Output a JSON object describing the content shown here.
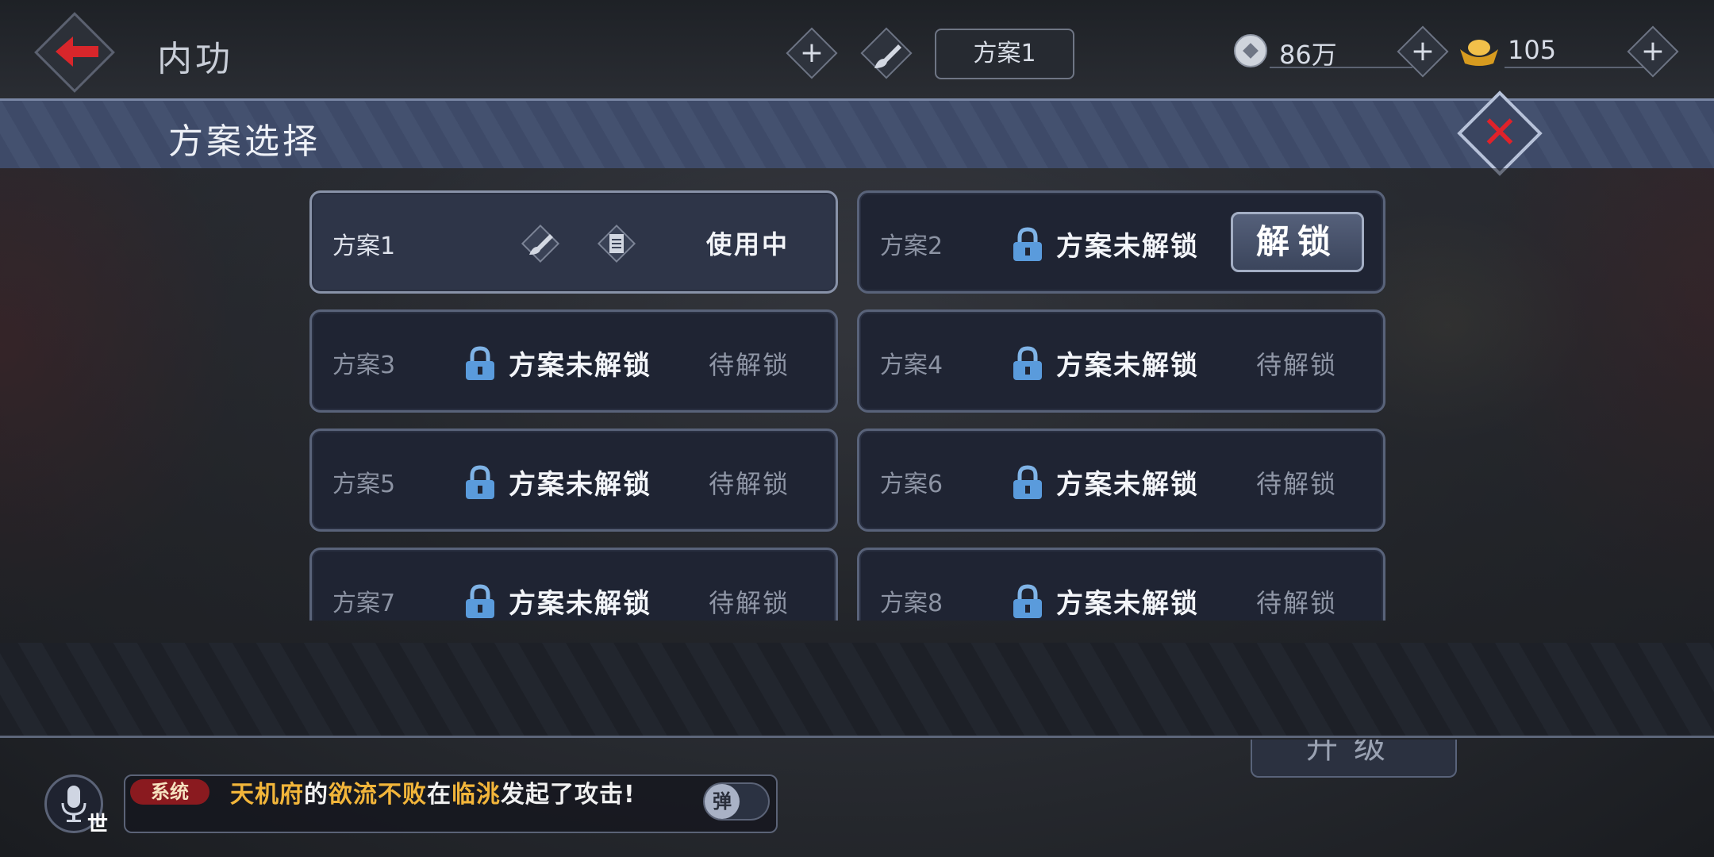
{
  "header": {
    "title": "内功",
    "plan_chip": "方案1"
  },
  "currency": {
    "coins": "86万",
    "ingots": "105"
  },
  "dialog": {
    "title": "方案选择"
  },
  "slots": [
    {
      "name": "方案1",
      "status": "使用中"
    },
    {
      "name": "方案2",
      "locked_text": "方案未解锁",
      "action": "解锁"
    },
    {
      "name": "方案3",
      "locked_text": "方案未解锁",
      "status": "待解锁"
    },
    {
      "name": "方案4",
      "locked_text": "方案未解锁",
      "status": "待解锁"
    },
    {
      "name": "方案5",
      "locked_text": "方案未解锁",
      "status": "待解锁"
    },
    {
      "name": "方案6",
      "locked_text": "方案未解锁",
      "status": "待解锁"
    },
    {
      "name": "方案7",
      "locked_text": "方案未解锁",
      "status": "待解锁"
    },
    {
      "name": "方案8",
      "locked_text": "方案未解锁",
      "status": "待解锁"
    }
  ],
  "background": {
    "upgrade_button": "升级"
  },
  "chat": {
    "channel": "世",
    "tag": "系统",
    "part1": "天机府",
    "part2": "的",
    "part3": "欲流不败",
    "part4": "在",
    "part5": "临洮",
    "part6": "发起了攻击!",
    "barrage_toggle": "弹"
  },
  "colors": {
    "accent_red": "#e0222a",
    "chat_highlight": "#f2b53a",
    "panel_blue": "#3f4b68"
  },
  "icons": [
    "back-arrow-icon",
    "plus-icon",
    "brush-icon",
    "coin-icon",
    "gold-ingot-icon",
    "close-icon",
    "lock-icon",
    "scroll-icon",
    "mic-icon"
  ]
}
